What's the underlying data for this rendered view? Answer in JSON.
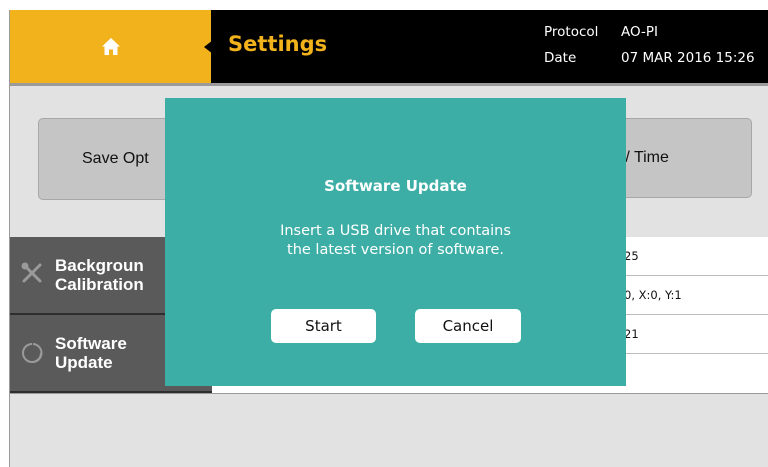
{
  "header": {
    "title": "Settings",
    "protocol_label": "Protocol",
    "protocol_value": "AO-PI",
    "date_label": "Date",
    "date_value": "07 MAR 2016 15:26"
  },
  "options": {
    "save_options_label": "Save Opt",
    "date_time_label": "e / Time"
  },
  "list": {
    "items": [
      {
        "label_line1": "Backgroun",
        "label_line2": "Calibration",
        "icon": "wrench-screwdriver-icon"
      },
      {
        "label_line1": "Software",
        "label_line2": "Update",
        "icon": "refresh-icon"
      }
    ],
    "values": [
      "25",
      "0, X:0, Y:1",
      "21"
    ]
  },
  "dialog": {
    "title": "Software Update",
    "message_line1": "Insert a USB drive that contains",
    "message_line2": "the latest version of software.",
    "start_label": "Start",
    "cancel_label": "Cancel"
  },
  "colors": {
    "accent": "#f2b21b",
    "dialog": "#3daea6",
    "header": "#000000",
    "sidebar": "#5a5a5a"
  }
}
